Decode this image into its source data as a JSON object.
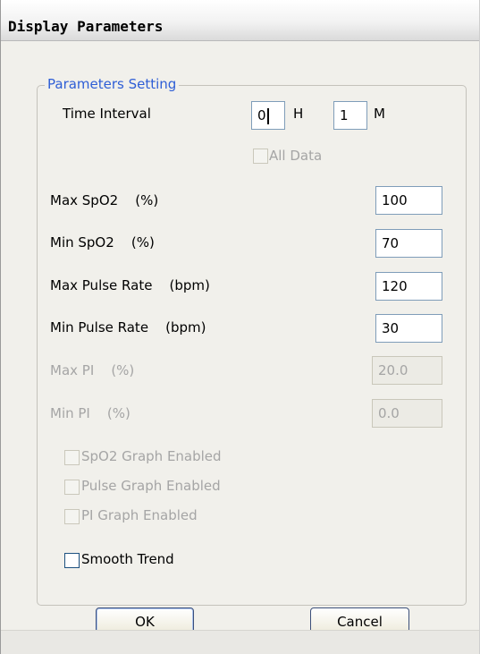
{
  "window": {
    "title": "Display Parameters"
  },
  "group": {
    "title": "Parameters Setting"
  },
  "time_interval": {
    "label": "Time Interval",
    "hours_value": "0",
    "hours_unit": "H",
    "minutes_value": "1",
    "minutes_unit": "M"
  },
  "all_data": {
    "label": "All Data",
    "checked": false,
    "enabled": false
  },
  "fields": [
    {
      "label": "Max SpO2    (%)",
      "value": "100",
      "enabled": true
    },
    {
      "label": "Min SpO2    (%)",
      "value": "70",
      "enabled": true
    },
    {
      "label": "Max Pulse Rate    (bpm)",
      "value": "120",
      "enabled": true
    },
    {
      "label": "Min Pulse Rate    (bpm)",
      "value": "30",
      "enabled": true
    },
    {
      "label": "Max PI    (%)",
      "value": "20.0",
      "enabled": false
    },
    {
      "label": "Min PI    (%)",
      "value": "0.0",
      "enabled": false
    }
  ],
  "graph_options": [
    {
      "label": "SpO2 Graph Enabled",
      "checked": false,
      "enabled": false
    },
    {
      "label": "Pulse Graph Enabled",
      "checked": false,
      "enabled": false
    },
    {
      "label": "PI Graph Enabled",
      "checked": false,
      "enabled": false
    }
  ],
  "smooth_trend": {
    "label": "Smooth Trend",
    "checked": false,
    "enabled": true
  },
  "buttons": {
    "ok": "OK",
    "cancel": "Cancel"
  }
}
